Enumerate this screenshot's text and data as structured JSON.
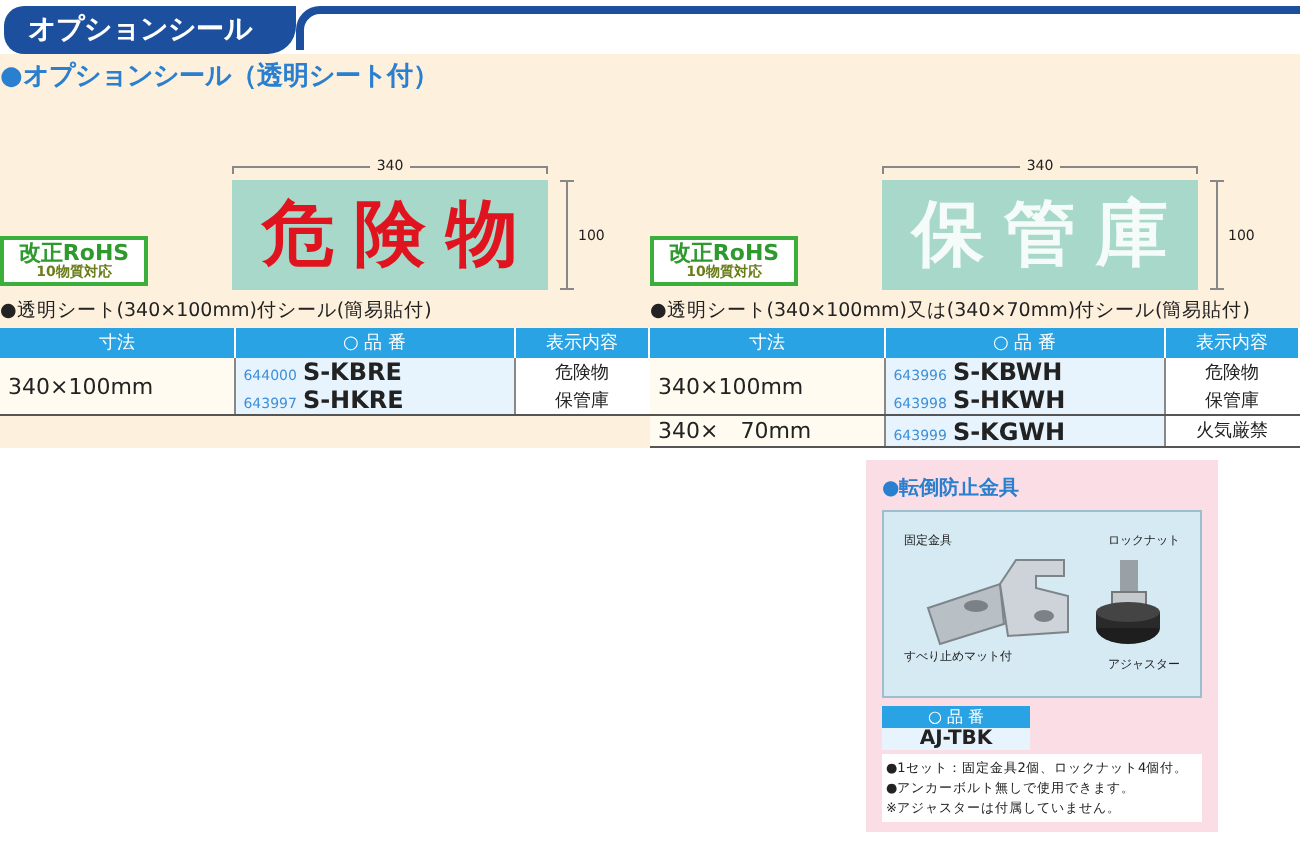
{
  "header": {
    "title": "オプションシール"
  },
  "section": {
    "title": "●オプションシール（透明シート付）",
    "products": [
      {
        "sign": {
          "text": "危険物",
          "kind": "red-text",
          "width_label": "340",
          "height_label": "100"
        },
        "badge": {
          "line1": "改正RoHS",
          "line2": "10物質対応"
        },
        "caption": "●透明シート(340×100mm)付シール(簡易貼付)",
        "columns": [
          "寸法",
          "○ 品 番",
          "表示内容"
        ],
        "rows": [
          {
            "size": "340×100mm",
            "items": [
              {
                "code": "644000",
                "model": "S-KBRE",
                "display": "危険物"
              },
              {
                "code": "643997",
                "model": "S-HKRE",
                "display": "保管庫"
              }
            ]
          }
        ]
      },
      {
        "sign": {
          "text": "保管庫",
          "kind": "white-text",
          "width_label": "340",
          "height_label": "100"
        },
        "badge": {
          "line1": "改正RoHS",
          "line2": "10物質対応"
        },
        "caption": "●透明シート(340×100mm)又は(340×70mm)付シール(簡易貼付)",
        "columns": [
          "寸法",
          "○ 品 番",
          "表示内容"
        ],
        "rows": [
          {
            "size": "340×100mm",
            "items": [
              {
                "code": "643996",
                "model": "S-KBWH",
                "display": "危険物"
              },
              {
                "code": "643998",
                "model": "S-HKWH",
                "display": "保管庫"
              }
            ]
          },
          {
            "size": "340×　70mm",
            "items": [
              {
                "code": "643999",
                "model": "S-KGWH",
                "display": "火気厳禁"
              }
            ]
          }
        ]
      }
    ]
  },
  "accessory": {
    "title": "●転倒防止金具",
    "labels": {
      "bracket": "固定金具",
      "mat": "すべり止めマット付",
      "nut": "ロックナット",
      "adjuster": "アジャスター"
    },
    "column": "○ 品 番",
    "model": "AJ-TBK",
    "notes": [
      "●1セット：固定金具2個、ロックナット4個付。",
      "●アンカーボルト無しで使用できます。",
      "※アジャスターは付属していません。"
    ]
  }
}
